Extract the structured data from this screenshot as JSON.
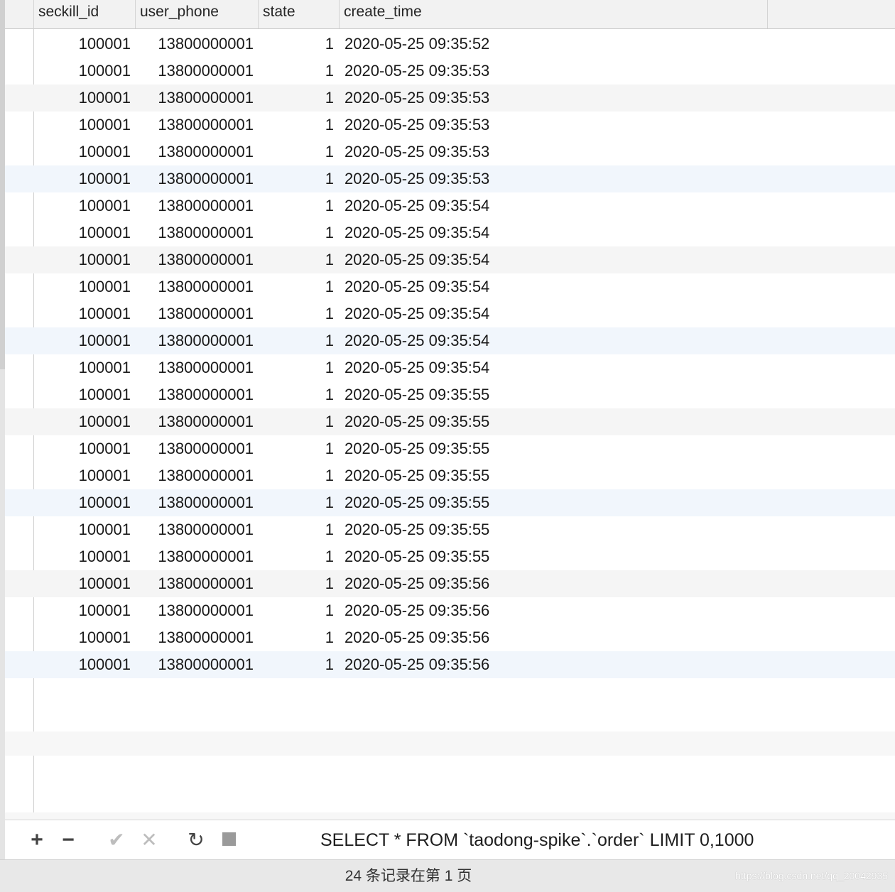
{
  "table": {
    "columns": [
      "seckill_id",
      "user_phone",
      "state",
      "create_time"
    ],
    "rows": [
      [
        "100001",
        "13800000001",
        "1",
        "2020-05-25 09:35:52"
      ],
      [
        "100001",
        "13800000001",
        "1",
        "2020-05-25 09:35:53"
      ],
      [
        "100001",
        "13800000001",
        "1",
        "2020-05-25 09:35:53"
      ],
      [
        "100001",
        "13800000001",
        "1",
        "2020-05-25 09:35:53"
      ],
      [
        "100001",
        "13800000001",
        "1",
        "2020-05-25 09:35:53"
      ],
      [
        "100001",
        "13800000001",
        "1",
        "2020-05-25 09:35:53"
      ],
      [
        "100001",
        "13800000001",
        "1",
        "2020-05-25 09:35:54"
      ],
      [
        "100001",
        "13800000001",
        "1",
        "2020-05-25 09:35:54"
      ],
      [
        "100001",
        "13800000001",
        "1",
        "2020-05-25 09:35:54"
      ],
      [
        "100001",
        "13800000001",
        "1",
        "2020-05-25 09:35:54"
      ],
      [
        "100001",
        "13800000001",
        "1",
        "2020-05-25 09:35:54"
      ],
      [
        "100001",
        "13800000001",
        "1",
        "2020-05-25 09:35:54"
      ],
      [
        "100001",
        "13800000001",
        "1",
        "2020-05-25 09:35:54"
      ],
      [
        "100001",
        "13800000001",
        "1",
        "2020-05-25 09:35:55"
      ],
      [
        "100001",
        "13800000001",
        "1",
        "2020-05-25 09:35:55"
      ],
      [
        "100001",
        "13800000001",
        "1",
        "2020-05-25 09:35:55"
      ],
      [
        "100001",
        "13800000001",
        "1",
        "2020-05-25 09:35:55"
      ],
      [
        "100001",
        "13800000001",
        "1",
        "2020-05-25 09:35:55"
      ],
      [
        "100001",
        "13800000001",
        "1",
        "2020-05-25 09:35:55"
      ],
      [
        "100001",
        "13800000001",
        "1",
        "2020-05-25 09:35:55"
      ],
      [
        "100001",
        "13800000001",
        "1",
        "2020-05-25 09:35:56"
      ],
      [
        "100001",
        "13800000001",
        "1",
        "2020-05-25 09:35:56"
      ],
      [
        "100001",
        "13800000001",
        "1",
        "2020-05-25 09:35:56"
      ],
      [
        "100001",
        "13800000001",
        "1",
        "2020-05-25 09:35:56"
      ]
    ]
  },
  "toolbar": {
    "add_icon": "plus-icon",
    "remove_icon": "minus-icon",
    "apply_icon": "check-icon",
    "discard_icon": "x-icon",
    "refresh_icon": "refresh-icon",
    "stop_icon": "stop-icon",
    "add_glyph": "+",
    "remove_glyph": "−",
    "apply_glyph": "✔",
    "discard_glyph": "✕",
    "refresh_glyph": "↻",
    "sql": "SELECT * FROM `taodong-spike`.`order` LIMIT 0,1000"
  },
  "status": {
    "text": "24 条记录在第 1 页",
    "watermark": "https://blog.csdn.net/qq_20042935"
  },
  "colors": {
    "header_bg": "#f2f2f2",
    "alt_row_bg": "#f5f5f5",
    "selected_row_bg": "#f1f6fc",
    "status_bg": "#e8e8e8"
  }
}
